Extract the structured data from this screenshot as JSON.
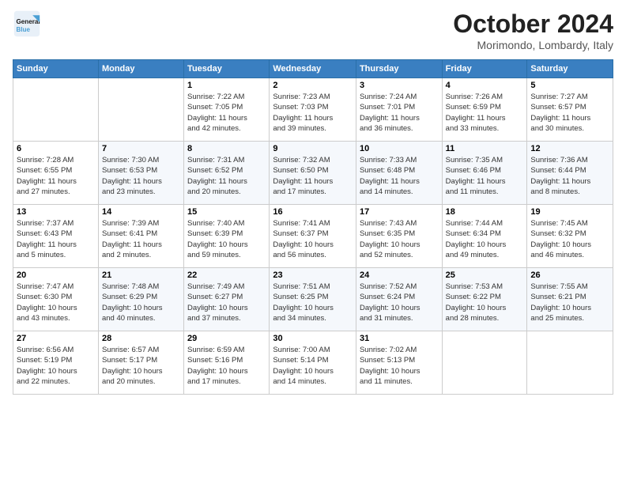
{
  "header": {
    "logo_line1": "General",
    "logo_line2": "Blue",
    "month_title": "October 2024",
    "subtitle": "Morimondo, Lombardy, Italy"
  },
  "weekdays": [
    "Sunday",
    "Monday",
    "Tuesday",
    "Wednesday",
    "Thursday",
    "Friday",
    "Saturday"
  ],
  "weeks": [
    [
      {
        "day": "",
        "info": ""
      },
      {
        "day": "",
        "info": ""
      },
      {
        "day": "1",
        "info": "Sunrise: 7:22 AM\nSunset: 7:05 PM\nDaylight: 11 hours\nand 42 minutes."
      },
      {
        "day": "2",
        "info": "Sunrise: 7:23 AM\nSunset: 7:03 PM\nDaylight: 11 hours\nand 39 minutes."
      },
      {
        "day": "3",
        "info": "Sunrise: 7:24 AM\nSunset: 7:01 PM\nDaylight: 11 hours\nand 36 minutes."
      },
      {
        "day": "4",
        "info": "Sunrise: 7:26 AM\nSunset: 6:59 PM\nDaylight: 11 hours\nand 33 minutes."
      },
      {
        "day": "5",
        "info": "Sunrise: 7:27 AM\nSunset: 6:57 PM\nDaylight: 11 hours\nand 30 minutes."
      }
    ],
    [
      {
        "day": "6",
        "info": "Sunrise: 7:28 AM\nSunset: 6:55 PM\nDaylight: 11 hours\nand 27 minutes."
      },
      {
        "day": "7",
        "info": "Sunrise: 7:30 AM\nSunset: 6:53 PM\nDaylight: 11 hours\nand 23 minutes."
      },
      {
        "day": "8",
        "info": "Sunrise: 7:31 AM\nSunset: 6:52 PM\nDaylight: 11 hours\nand 20 minutes."
      },
      {
        "day": "9",
        "info": "Sunrise: 7:32 AM\nSunset: 6:50 PM\nDaylight: 11 hours\nand 17 minutes."
      },
      {
        "day": "10",
        "info": "Sunrise: 7:33 AM\nSunset: 6:48 PM\nDaylight: 11 hours\nand 14 minutes."
      },
      {
        "day": "11",
        "info": "Sunrise: 7:35 AM\nSunset: 6:46 PM\nDaylight: 11 hours\nand 11 minutes."
      },
      {
        "day": "12",
        "info": "Sunrise: 7:36 AM\nSunset: 6:44 PM\nDaylight: 11 hours\nand 8 minutes."
      }
    ],
    [
      {
        "day": "13",
        "info": "Sunrise: 7:37 AM\nSunset: 6:43 PM\nDaylight: 11 hours\nand 5 minutes."
      },
      {
        "day": "14",
        "info": "Sunrise: 7:39 AM\nSunset: 6:41 PM\nDaylight: 11 hours\nand 2 minutes."
      },
      {
        "day": "15",
        "info": "Sunrise: 7:40 AM\nSunset: 6:39 PM\nDaylight: 10 hours\nand 59 minutes."
      },
      {
        "day": "16",
        "info": "Sunrise: 7:41 AM\nSunset: 6:37 PM\nDaylight: 10 hours\nand 56 minutes."
      },
      {
        "day": "17",
        "info": "Sunrise: 7:43 AM\nSunset: 6:35 PM\nDaylight: 10 hours\nand 52 minutes."
      },
      {
        "day": "18",
        "info": "Sunrise: 7:44 AM\nSunset: 6:34 PM\nDaylight: 10 hours\nand 49 minutes."
      },
      {
        "day": "19",
        "info": "Sunrise: 7:45 AM\nSunset: 6:32 PM\nDaylight: 10 hours\nand 46 minutes."
      }
    ],
    [
      {
        "day": "20",
        "info": "Sunrise: 7:47 AM\nSunset: 6:30 PM\nDaylight: 10 hours\nand 43 minutes."
      },
      {
        "day": "21",
        "info": "Sunrise: 7:48 AM\nSunset: 6:29 PM\nDaylight: 10 hours\nand 40 minutes."
      },
      {
        "day": "22",
        "info": "Sunrise: 7:49 AM\nSunset: 6:27 PM\nDaylight: 10 hours\nand 37 minutes."
      },
      {
        "day": "23",
        "info": "Sunrise: 7:51 AM\nSunset: 6:25 PM\nDaylight: 10 hours\nand 34 minutes."
      },
      {
        "day": "24",
        "info": "Sunrise: 7:52 AM\nSunset: 6:24 PM\nDaylight: 10 hours\nand 31 minutes."
      },
      {
        "day": "25",
        "info": "Sunrise: 7:53 AM\nSunset: 6:22 PM\nDaylight: 10 hours\nand 28 minutes."
      },
      {
        "day": "26",
        "info": "Sunrise: 7:55 AM\nSunset: 6:21 PM\nDaylight: 10 hours\nand 25 minutes."
      }
    ],
    [
      {
        "day": "27",
        "info": "Sunrise: 6:56 AM\nSunset: 5:19 PM\nDaylight: 10 hours\nand 22 minutes."
      },
      {
        "day": "28",
        "info": "Sunrise: 6:57 AM\nSunset: 5:17 PM\nDaylight: 10 hours\nand 20 minutes."
      },
      {
        "day": "29",
        "info": "Sunrise: 6:59 AM\nSunset: 5:16 PM\nDaylight: 10 hours\nand 17 minutes."
      },
      {
        "day": "30",
        "info": "Sunrise: 7:00 AM\nSunset: 5:14 PM\nDaylight: 10 hours\nand 14 minutes."
      },
      {
        "day": "31",
        "info": "Sunrise: 7:02 AM\nSunset: 5:13 PM\nDaylight: 10 hours\nand 11 minutes."
      },
      {
        "day": "",
        "info": ""
      },
      {
        "day": "",
        "info": ""
      }
    ]
  ]
}
